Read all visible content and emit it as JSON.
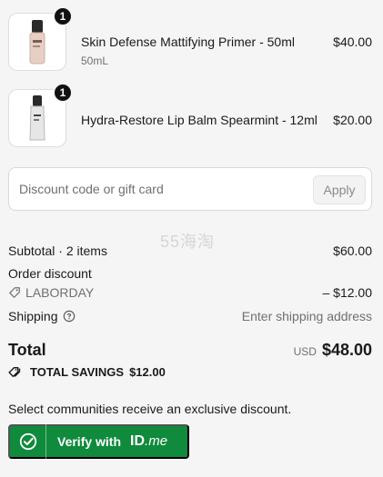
{
  "cart": {
    "items": [
      {
        "name": "Skin Defense Mattifying Primer - 50ml",
        "variant": "50mL",
        "price": "$40.00",
        "quantity": "1",
        "image_icon": "primer-tube-image"
      },
      {
        "name": "Hydra-Restore Lip Balm Spearmint - 12ml",
        "variant": "",
        "price": "$20.00",
        "quantity": "1",
        "image_icon": "lip-balm-tube-image"
      }
    ]
  },
  "discount": {
    "placeholder": "Discount code or gift card",
    "apply_label": "Apply"
  },
  "watermark": "55海淘",
  "summary": {
    "subtotal_label": "Subtotal · 2 items",
    "subtotal_value": "$60.00",
    "order_discount_label": "Order discount",
    "discount_code": "LABORDAY",
    "discount_value": "– $12.00",
    "shipping_label": "Shipping",
    "shipping_value": "Enter shipping address",
    "total_label": "Total",
    "total_currency": "USD",
    "total_value": "$48.00",
    "savings_label": "TOTAL SAVINGS",
    "savings_value": "$12.00"
  },
  "verify": {
    "communities_text": "Select communities receive an exclusive discount.",
    "button_label": "Verify with",
    "logo_id": "ID",
    "logo_me": ".me"
  },
  "colors": {
    "background": "#f5f5f5",
    "verify_green": "#108a3c",
    "muted_text": "#707070"
  }
}
